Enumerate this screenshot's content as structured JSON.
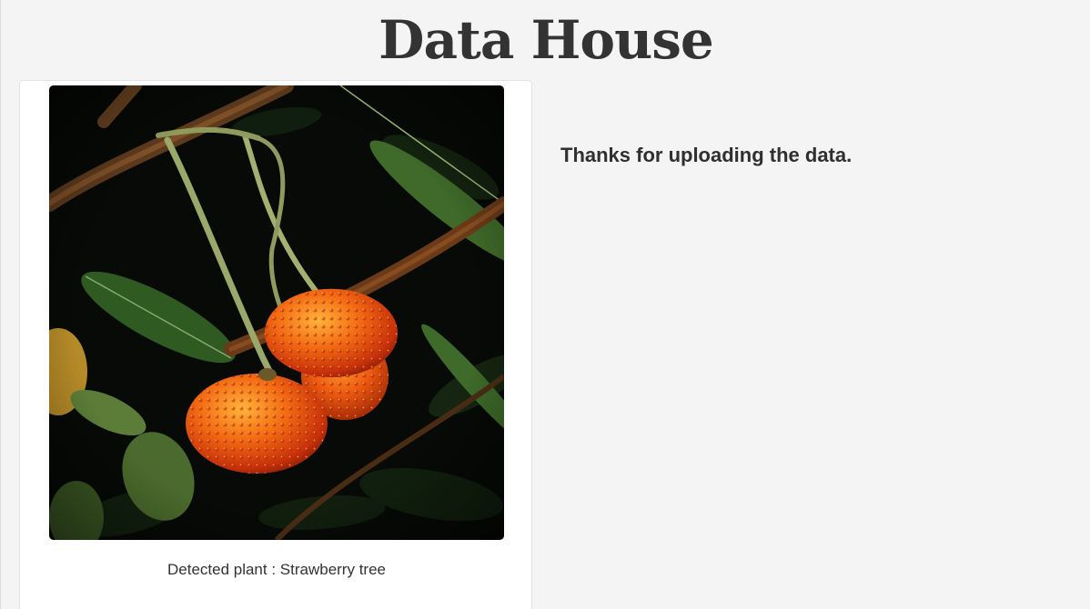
{
  "header": {
    "title": "Data House"
  },
  "result_card": {
    "image_alt": "Strawberry tree",
    "caption": "Detected plant : Strawberry tree"
  },
  "main": {
    "message": "Thanks for uploading the data."
  }
}
